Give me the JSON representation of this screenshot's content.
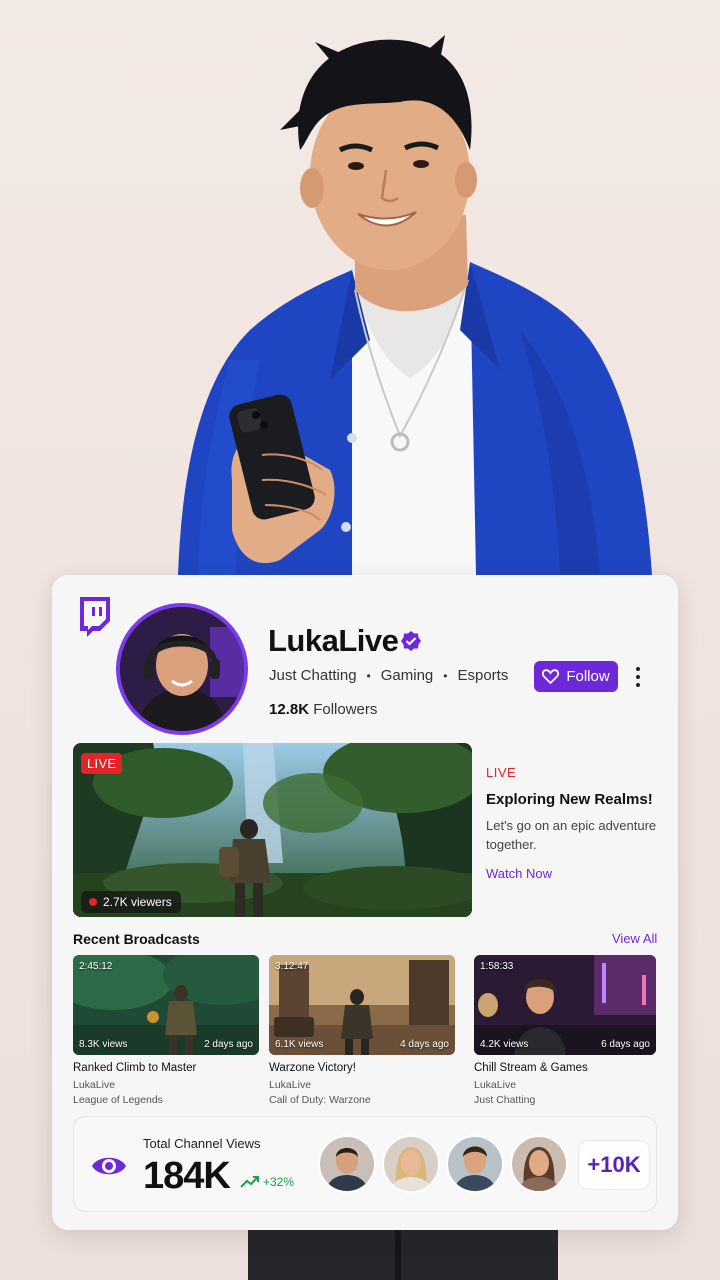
{
  "channel": {
    "name": "LukaLive",
    "categories": [
      "Just Chatting",
      "Gaming",
      "Esports"
    ],
    "followers_count": "12.8K",
    "followers_label": "Followers",
    "follow_label": "Follow"
  },
  "stream": {
    "badge": "LIVE",
    "viewers": "2.7K viewers",
    "status": "LIVE",
    "title": "Exploring New Realms!",
    "description": "Let's go on an epic adventure together.",
    "cta": "Watch Now"
  },
  "recent": {
    "title": "Recent Broadcasts",
    "view_all": "View All",
    "items": [
      {
        "duration": "2:45:12",
        "views": "8.3K views",
        "ago": "2 days ago",
        "title": "Ranked Climb to Master",
        "channel": "LukaLive",
        "game": "League of Legends"
      },
      {
        "duration": "3:12:47",
        "views": "6.1K views",
        "ago": "4 days ago",
        "title": "Warzone Victory!",
        "channel": "LukaLive",
        "game": "Call of Duty: Warzone"
      },
      {
        "duration": "1:58:33",
        "views": "4.2K views",
        "ago": "6 days ago",
        "title": "Chill Stream & Games",
        "channel": "LukaLive",
        "game": "Just Chatting"
      }
    ]
  },
  "stats": {
    "label": "Total Channel Views",
    "value": "184K",
    "growth": "+32%",
    "more_followers": "+10K"
  },
  "colors": {
    "brand": "#6d28d9",
    "live": "#e3232b",
    "growth": "#16a34a"
  },
  "icons": [
    "twitch-logo-icon",
    "verified-icon",
    "heart-icon",
    "more-vertical-icon",
    "eye-icon",
    "trend-up-icon"
  ]
}
